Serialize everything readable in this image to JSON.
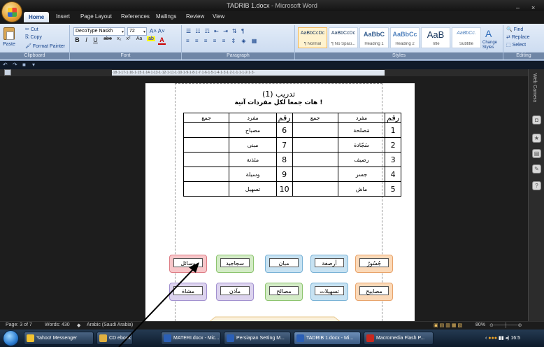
{
  "window": {
    "doc_title": "TADRIB 1.docx",
    "app_title": " - Microsoft Word",
    "controls": [
      "–",
      "×"
    ]
  },
  "tabs": [
    "Home",
    "Insert",
    "Page Layout",
    "References",
    "Mailings",
    "Review",
    "View"
  ],
  "clipboard": {
    "paste": "Paste",
    "cut": "Cut",
    "copy": "Copy",
    "format_painter": "Format Painter",
    "label": "Clipboard"
  },
  "font_group": {
    "font_name": "DecoType Naskh",
    "font_size": "72",
    "label": "Font",
    "format_buttons": [
      "B",
      "I",
      "U",
      "abe",
      "x₂",
      "x²",
      "Aa"
    ]
  },
  "paragraph_group": {
    "label": "Paragraph"
  },
  "styles": {
    "items": [
      {
        "sample": "AaBbCcDc",
        "name": "¶ Normal"
      },
      {
        "sample": "AaBbCcDc",
        "name": "¶ No Spaci..."
      },
      {
        "sample": "AaBbC",
        "name": "Heading 1"
      },
      {
        "sample": "AaBbCc",
        "name": "Heading 2"
      },
      {
        "sample": "AaB",
        "name": "Title"
      },
      {
        "sample": "AaBbCc.",
        "name": "Subtitle"
      }
    ],
    "change_styles": "Change Styles",
    "label": "Styles"
  },
  "editing": {
    "find": "Find",
    "replace": "Replace",
    "select": "Select",
    "label": "Editing"
  },
  "ruler_text": "·18·1·17·1·16·1·15·1·14·1·13·1·12·1·11·1·10·1·9·1·8·1·7·1·6·1·5·1·4·1·3·1·2·1·1·1·1·2·1·3·",
  "sidebar": {
    "label": "Web Camera"
  },
  "document": {
    "title": "تدريب (1)",
    "subtitle": "هات جمعا لكل مفردات آتية !",
    "table": {
      "headers": [
        "رقم",
        "مفرد",
        "جمع",
        "رقم",
        "مفرد",
        "جمع"
      ],
      "rows": [
        [
          "1",
          "مَصلحة",
          "",
          "6",
          "مصباح",
          ""
        ],
        [
          "2",
          "سَجّادة",
          "",
          "7",
          "مبنى",
          ""
        ],
        [
          "3",
          "رصيف",
          "",
          "8",
          "مئذنة",
          ""
        ],
        [
          "4",
          "جسر",
          "",
          "9",
          "وسيلة",
          ""
        ],
        [
          "5",
          "ماش",
          "",
          "10",
          "تسهيل",
          ""
        ]
      ]
    },
    "cards_row1": [
      "جُسُورٌ",
      "أرصفة",
      "مبان",
      "سجاجيد",
      "وسائل"
    ],
    "cards_row2": [
      "مصابيح",
      "تسهيلات",
      "مصالح",
      "مآذن",
      "مشاة"
    ]
  },
  "status": {
    "page": "Page: 3 of 7",
    "words": "Words: 430",
    "language": "Arabic (Saudi Arabia)",
    "zoom": "80%"
  },
  "taskbar": {
    "tasks": [
      {
        "label": "Yahoo! Messenger",
        "color": "#f2c230"
      },
      {
        "label": "CD ebook",
        "color": "#e0b040"
      },
      {
        "label": "MATERI.docx - Mic...",
        "color": "#2b5fb5"
      },
      {
        "label": "Persiapan Setting M...",
        "color": "#2b5fb5"
      },
      {
        "label": "TADRIB 1.docx - Mi...",
        "color": "#2b5fb5"
      },
      {
        "label": "Macromedia Flash P...",
        "color": "#c8281e"
      }
    ],
    "clock": "16:5"
  },
  "colors": {
    "card_pink": "#f7c6c9",
    "card_green": "#d3ebc6",
    "card_blue": "#c7e2f2",
    "card_orange": "#fbd9b8",
    "card_lavender": "#dcd3ee"
  }
}
